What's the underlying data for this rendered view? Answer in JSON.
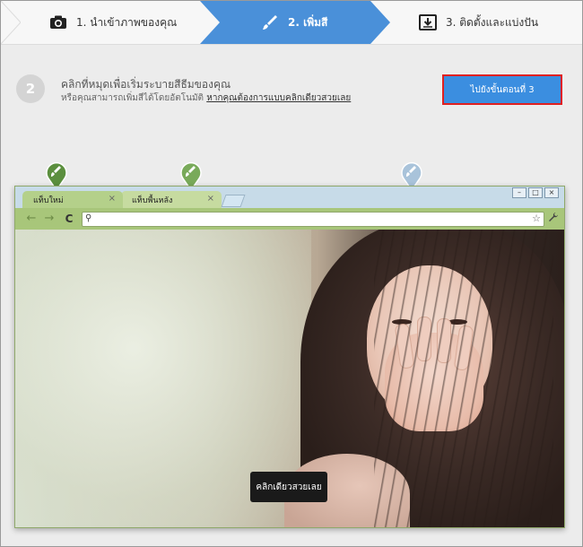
{
  "steps": [
    {
      "label": "1. นำเข้าภาพของคุณ",
      "icon": "camera-icon"
    },
    {
      "label": "2. เพิ่มสี",
      "icon": "paint-brush-icon"
    },
    {
      "label": "3. ติดตั้งและแบ่งปัน",
      "icon": "download-box-icon"
    }
  ],
  "instruction": {
    "step_number": "2",
    "title": "คลิกที่หมุดเพื่อเริ่มระบายสีธีมของคุณ",
    "subtitle": "หรือคุณสามารถเพิ่มสีได้โดยอัตโนมัติ",
    "link": "หากคุณต้องการแบบคลิกเดียวสวยเลย"
  },
  "next_button": "ไปยังขั้นตอนที่ 3",
  "browser": {
    "tabs": [
      "แท็บใหม่",
      "แท็บพื้นหลัง"
    ],
    "tab_close": "×",
    "window_buttons": [
      "–",
      "□",
      "×"
    ],
    "back": "←",
    "forward": "→",
    "reload": "C",
    "address_value": "",
    "search_icon_glyph": "⚲",
    "star_glyph": "☆",
    "wrench_glyph": "🔧"
  },
  "one_click_button": "คลิกเดียวสวยเลย",
  "colors": {
    "accent": "#4a90d9",
    "button_border": "#e02020",
    "pin_green": "#5b8f3e",
    "pin_blue": "#a9c3da"
  }
}
